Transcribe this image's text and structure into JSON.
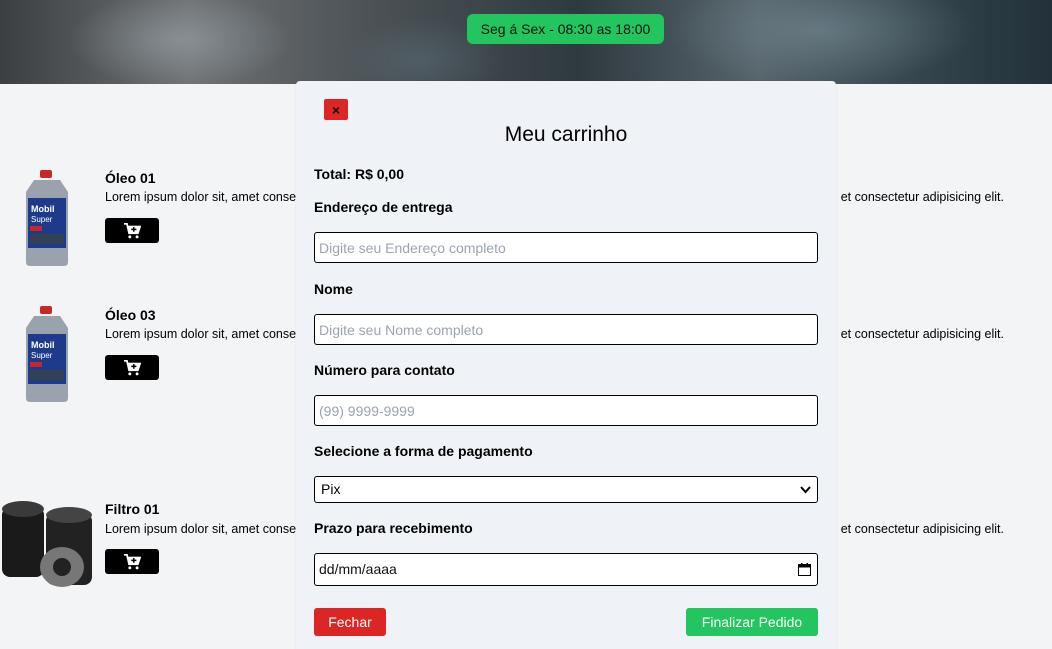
{
  "header": {
    "hours": "Seg á Sex - 08:30 as 18:00"
  },
  "products": [
    {
      "name": "Óleo 01",
      "description": "Lorem ipsum dolor sit, amet consectetur adipisicing elit.",
      "visible_desc_start": "Lorem ipsum dolor sit, amet conse",
      "visible_desc_end": "et consectetur adipisicing elit.",
      "image": "motor-oil-bottle",
      "cart_icon": "cart-plus-icon"
    },
    {
      "name": "Óleo 03",
      "description": "Lorem ipsum dolor sit, amet consectetur adipisicing elit.",
      "visible_desc_start": "Lorem ipsum dolor sit, amet conse",
      "visible_desc_end": "et consectetur adipisicing elit.",
      "image": "motor-oil-bottle",
      "cart_icon": "cart-plus-icon"
    },
    {
      "name": "Filtro 01",
      "description": "Lorem ipsum dolor sit, amet consectetur adipisicing elit.",
      "visible_desc_start": "Lorem ipsum dolor sit, amet conse",
      "visible_desc_end": "et consectetur adipisicing elit.",
      "image": "oil-filter",
      "cart_icon": "cart-plus-icon"
    }
  ],
  "cart_modal": {
    "close_icon": "×",
    "title": "Meu carrinho",
    "total": "Total: R$ 0,00",
    "address_label": "Endereço de entrega",
    "address_placeholder": "Digite seu Endereço completo",
    "name_label": "Nome",
    "name_placeholder": "Digite seu Nome completo",
    "phone_label": "Número para contato",
    "phone_placeholder": "(99) 9999-9999",
    "payment_label": "Selecione a forma de pagamento",
    "payment_selected": "Pix",
    "deadline_label": "Prazo para recebimento",
    "deadline_value": "dd/mm/aaaa",
    "close_button": "Fechar",
    "finish_button": "Finalizar Pedido"
  },
  "colors": {
    "accent_green": "#22c55e",
    "danger_red": "#dc2626",
    "cart_button": "#000000"
  }
}
